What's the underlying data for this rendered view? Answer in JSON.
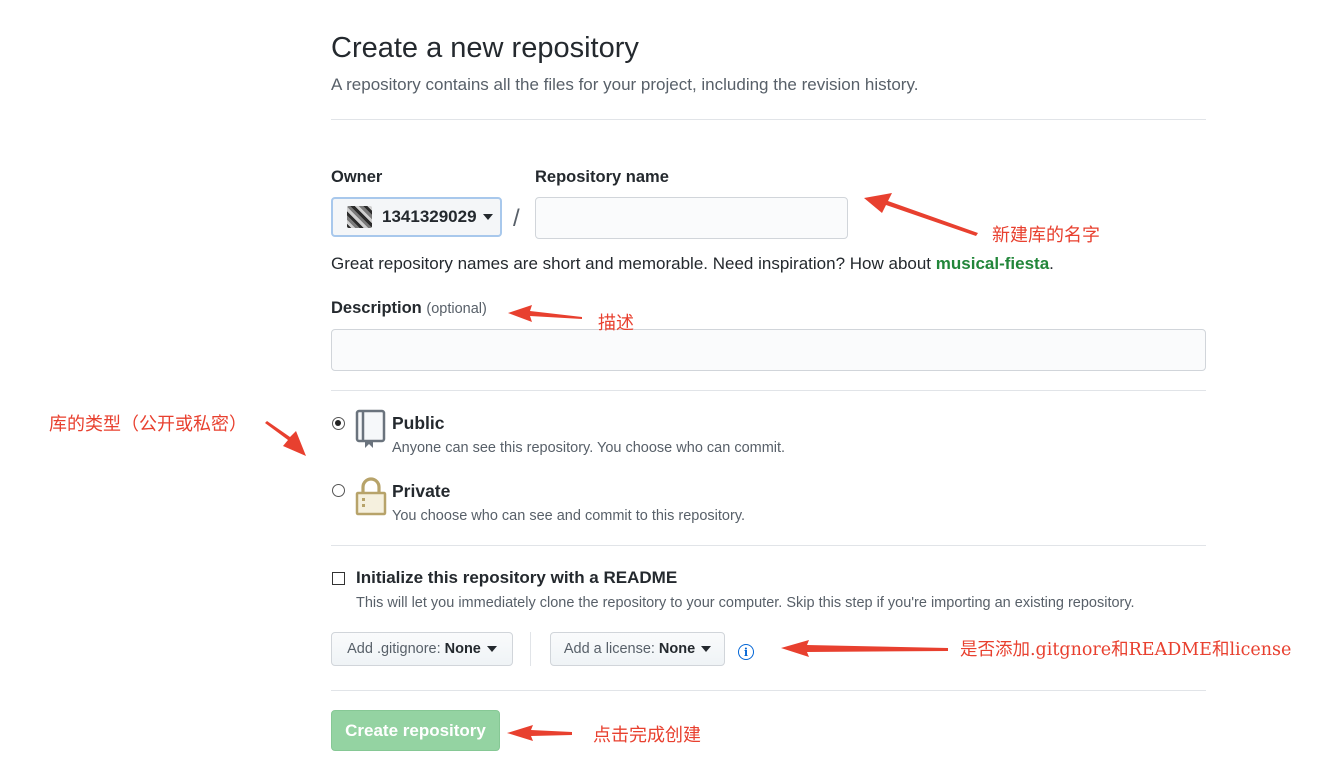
{
  "header": {
    "title": "Create a new repository",
    "subtitle": "A repository contains all the files for your project, including the revision history."
  },
  "owner": {
    "label": "Owner",
    "value": "1341329029"
  },
  "repo_name": {
    "label": "Repository name",
    "value": "",
    "separator": "/"
  },
  "name_help": {
    "text": "Great repository names are short and memorable. Need inspiration? How about ",
    "suggestion": "musical-fiesta",
    "end": "."
  },
  "description": {
    "label": "Description",
    "optional": "(optional)",
    "value": ""
  },
  "visibility": {
    "selected": "public",
    "public": {
      "title": "Public",
      "desc": "Anyone can see this repository. You choose who can commit."
    },
    "private": {
      "title": "Private",
      "desc": "You choose who can see and commit to this repository."
    }
  },
  "readme": {
    "checked": false,
    "label": "Initialize this repository with a README",
    "desc": "This will let you immediately clone the repository to your computer. Skip this step if you're importing an existing repository."
  },
  "gitignore": {
    "prefix": "Add .gitignore:",
    "value": "None"
  },
  "license": {
    "prefix": "Add a license:",
    "value": "None"
  },
  "info_icon": "i",
  "create_button": "Create repository",
  "annotations": {
    "repo_name": "新建库的名字",
    "description": "描述",
    "visibility": "库的类型（公开或私密）",
    "extras": "是否添加.gitgnore和README和license",
    "create": "点击完成创建"
  },
  "colors": {
    "accent_green": "#94d3a2",
    "annotation_red": "#e8402f",
    "suggestion_green": "#22863a"
  }
}
